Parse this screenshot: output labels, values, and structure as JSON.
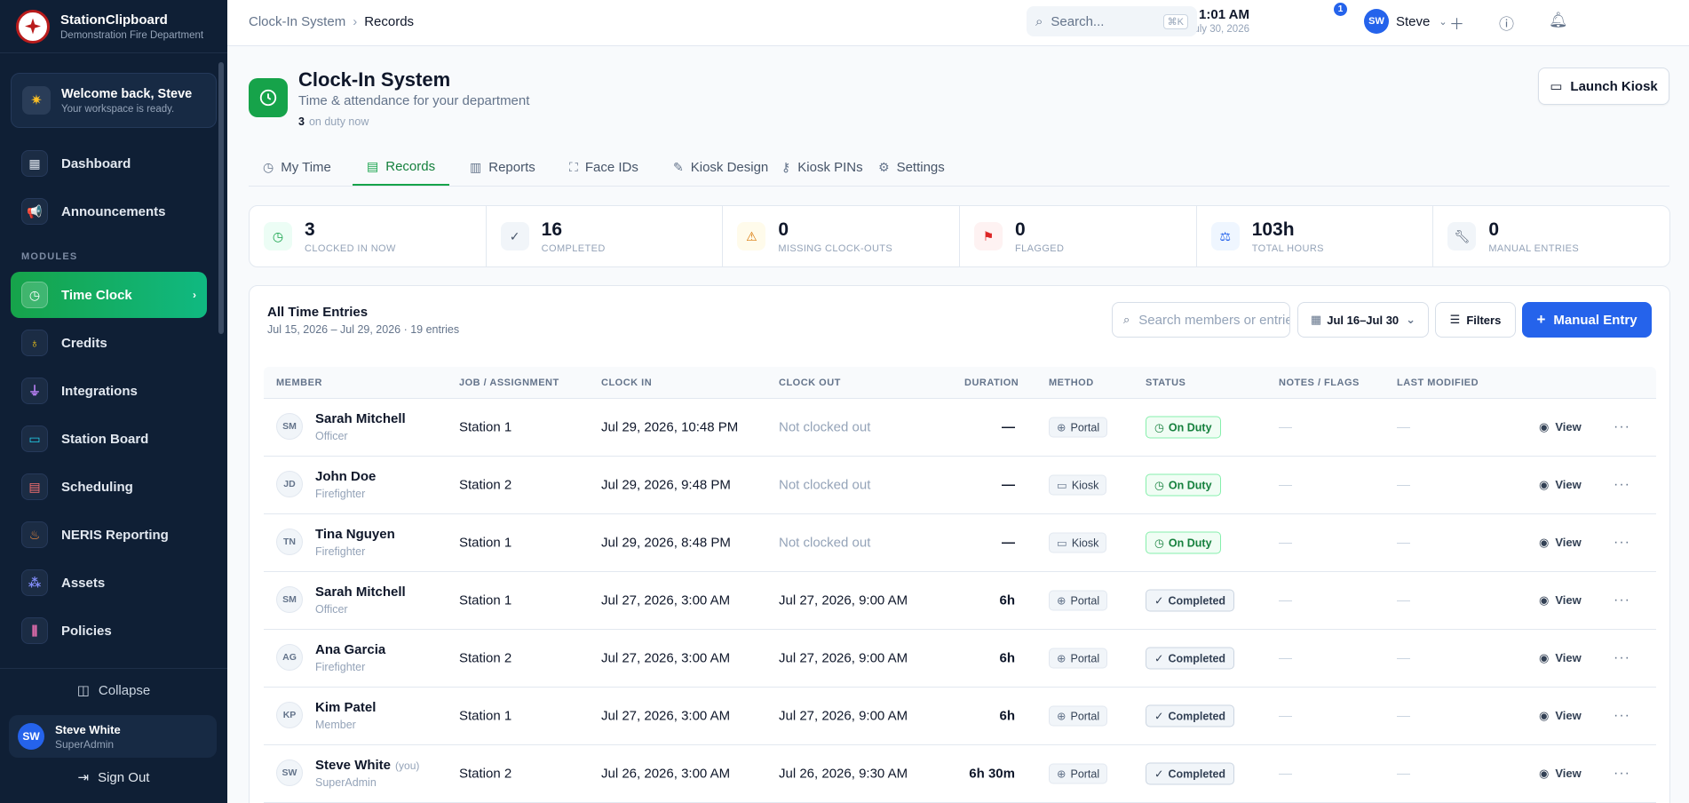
{
  "brand": {
    "name": "StationClipboard",
    "sub": "Demonstration Fire Department"
  },
  "welcome": {
    "title": "Welcome back, Steve",
    "sub": "Your workspace is ready."
  },
  "nav": {
    "dashboard": "Dashboard",
    "announcements": "Announcements",
    "modules_label": "MODULES",
    "time_clock": "Time Clock",
    "credits": "Credits",
    "integrations": "Integrations",
    "station_board": "Station Board",
    "scheduling": "Scheduling",
    "neris": "NERIS Reporting",
    "assets": "Assets",
    "policies": "Policies",
    "collapse": "Collapse",
    "sign_out": "Sign Out"
  },
  "sidebar_user": {
    "initials": "SW",
    "name": "Steve White",
    "role": "SuperAdmin"
  },
  "breadcrumb": {
    "parent": "Clock-In System",
    "sep": "›",
    "current": "Records"
  },
  "clock": {
    "time": "1:01 AM",
    "date": "July 30, 2026"
  },
  "top_search": {
    "placeholder": "Search...",
    "kbd": "⌘K"
  },
  "notifications": {
    "count": "1"
  },
  "top_user": {
    "initials": "SW",
    "name": "Steve"
  },
  "page": {
    "title": "Clock-In System",
    "subtitle": "Time & attendance for your department",
    "on_duty_count": "3",
    "on_duty_label": "on duty now",
    "launch_kiosk": "Launch Kiosk"
  },
  "tabs": {
    "my_time": "My Time",
    "records": "Records",
    "reports": "Reports",
    "face_ids": "Face IDs",
    "kiosk_design": "Kiosk Design",
    "kiosk_pins": "Kiosk PINs",
    "settings": "Settings"
  },
  "stats": [
    {
      "value": "3",
      "label": "CLOCKED IN NOW",
      "color": "#16a34a",
      "bg": "#ecfdf5",
      "icon": "clock-icon"
    },
    {
      "value": "16",
      "label": "COMPLETED",
      "color": "#475569",
      "bg": "#f1f5f9",
      "icon": "check-circle-icon"
    },
    {
      "value": "0",
      "label": "MISSING CLOCK-OUTS",
      "color": "#d97706",
      "bg": "#fffbeb",
      "icon": "warning-icon"
    },
    {
      "value": "0",
      "label": "FLAGGED",
      "color": "#dc2626",
      "bg": "#fef2f2",
      "icon": "flag-icon"
    },
    {
      "value": "103h",
      "label": "TOTAL HOURS",
      "color": "#2563eb",
      "bg": "#eff6ff",
      "icon": "scale-icon"
    },
    {
      "value": "0",
      "label": "MANUAL ENTRIES",
      "color": "#475569",
      "bg": "#f1f5f9",
      "icon": "wrench-icon"
    }
  ],
  "entries": {
    "title": "All Time Entries",
    "subtitle": "Jul 15, 2026 – Jul 29, 2026 · 19 entries",
    "search_placeholder": "Search members or entries",
    "date_range": "Jul 16–Jul 30",
    "filters": "Filters",
    "manual_entry": "Manual Entry"
  },
  "columns": {
    "member": "MEMBER",
    "job": "JOB / ASSIGNMENT",
    "clock_in": "CLOCK IN",
    "clock_out": "CLOCK OUT",
    "duration": "DURATION",
    "method": "METHOD",
    "status": "STATUS",
    "notes": "NOTES / FLAGS",
    "last_modified": "LAST MODIFIED"
  },
  "row_actions": {
    "view": "View",
    "more": "···",
    "empty": "—"
  },
  "rows": [
    {
      "initials": "SM",
      "name": "Sarah Mitchell",
      "you": "",
      "role": "Officer",
      "job": "Station 1",
      "clock_in": "Jul 29, 2026, 10:48 PM",
      "clock_out": "Not clocked out",
      "duration": "—",
      "method": "Portal",
      "status": "On Duty"
    },
    {
      "initials": "JD",
      "name": "John Doe",
      "you": "",
      "role": "Firefighter",
      "job": "Station 2",
      "clock_in": "Jul 29, 2026, 9:48 PM",
      "clock_out": "Not clocked out",
      "duration": "—",
      "method": "Kiosk",
      "status": "On Duty"
    },
    {
      "initials": "TN",
      "name": "Tina Nguyen",
      "you": "",
      "role": "Firefighter",
      "job": "Station 1",
      "clock_in": "Jul 29, 2026, 8:48 PM",
      "clock_out": "Not clocked out",
      "duration": "—",
      "method": "Kiosk",
      "status": "On Duty"
    },
    {
      "initials": "SM",
      "name": "Sarah Mitchell",
      "you": "",
      "role": "Officer",
      "job": "Station 1",
      "clock_in": "Jul 27, 2026, 3:00 AM",
      "clock_out": "Jul 27, 2026, 9:00 AM",
      "duration": "6h",
      "method": "Portal",
      "status": "Completed"
    },
    {
      "initials": "AG",
      "name": "Ana Garcia",
      "you": "",
      "role": "Firefighter",
      "job": "Station 2",
      "clock_in": "Jul 27, 2026, 3:00 AM",
      "clock_out": "Jul 27, 2026, 9:00 AM",
      "duration": "6h",
      "method": "Portal",
      "status": "Completed"
    },
    {
      "initials": "KP",
      "name": "Kim Patel",
      "you": "",
      "role": "Member",
      "job": "Station 1",
      "clock_in": "Jul 27, 2026, 3:00 AM",
      "clock_out": "Jul 27, 2026, 9:00 AM",
      "duration": "6h",
      "method": "Portal",
      "status": "Completed"
    },
    {
      "initials": "SW",
      "name": "Steve White",
      "you": "(you)",
      "role": "SuperAdmin",
      "job": "Station 2",
      "clock_in": "Jul 26, 2026, 3:00 AM",
      "clock_out": "Jul 26, 2026, 9:30 AM",
      "duration": "6h 30m",
      "method": "Portal",
      "status": "Completed"
    }
  ]
}
